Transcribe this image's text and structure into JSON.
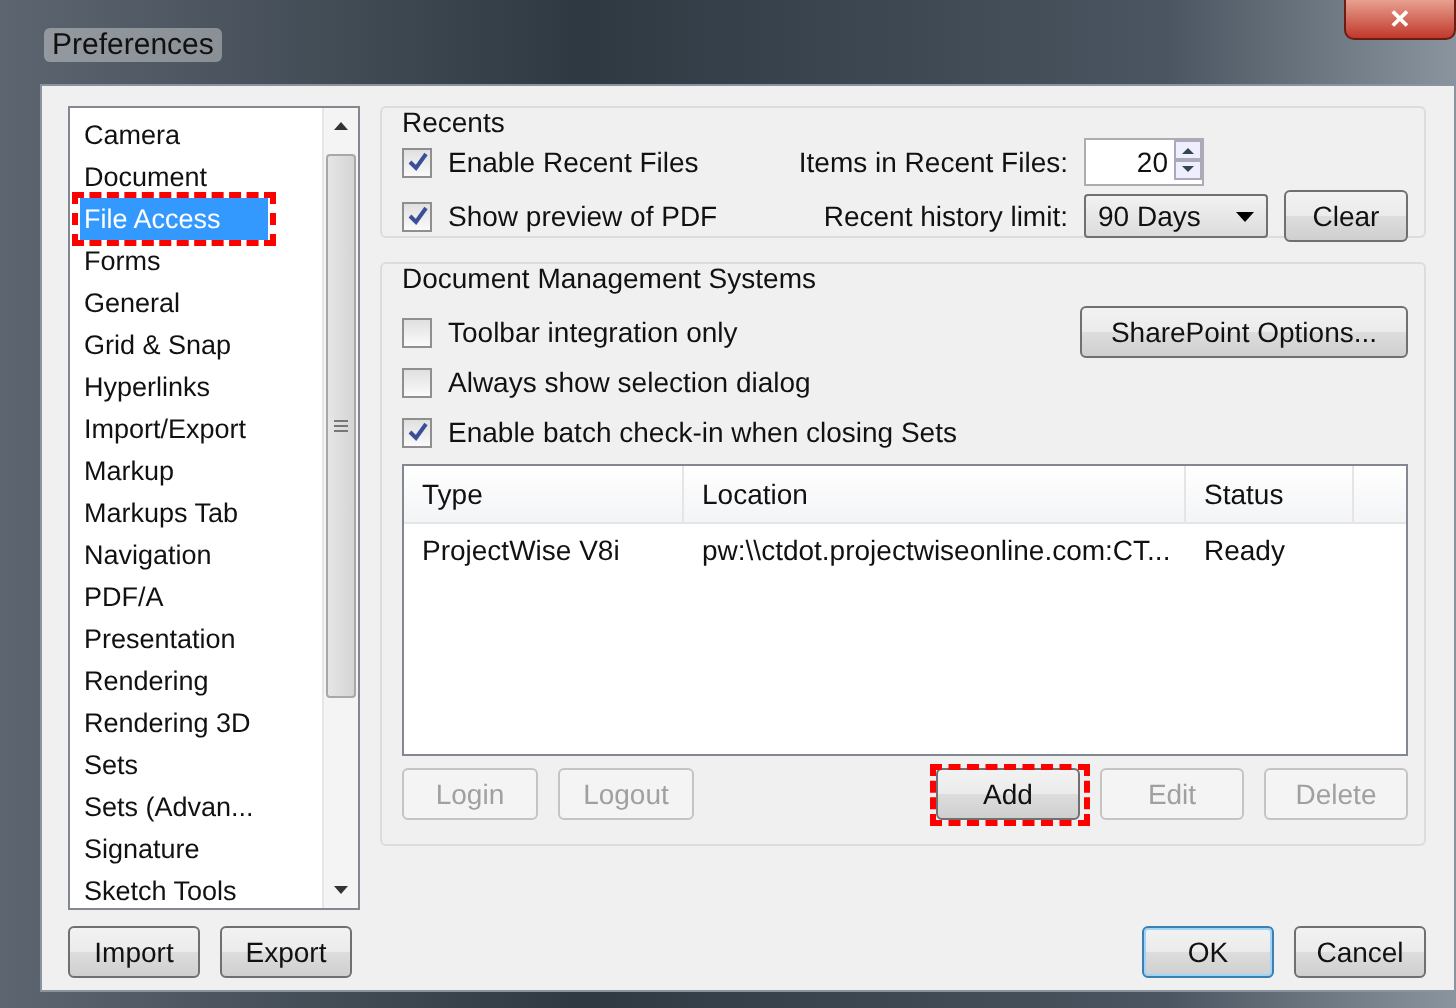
{
  "window": {
    "title": "Preferences",
    "close": "✕"
  },
  "sidebar": {
    "items": [
      {
        "label": "Camera",
        "selected": false
      },
      {
        "label": "Document",
        "selected": false
      },
      {
        "label": "File Access",
        "selected": true
      },
      {
        "label": "Forms",
        "selected": false
      },
      {
        "label": "General",
        "selected": false
      },
      {
        "label": "Grid & Snap",
        "selected": false
      },
      {
        "label": "Hyperlinks",
        "selected": false
      },
      {
        "label": "Import/Export",
        "selected": false
      },
      {
        "label": "Markup",
        "selected": false
      },
      {
        "label": "Markups Tab",
        "selected": false
      },
      {
        "label": "Navigation",
        "selected": false
      },
      {
        "label": "PDF/A",
        "selected": false
      },
      {
        "label": "Presentation",
        "selected": false
      },
      {
        "label": "Rendering",
        "selected": false
      },
      {
        "label": "Rendering 3D",
        "selected": false
      },
      {
        "label": "Sets",
        "selected": false
      },
      {
        "label": "Sets (Advan...",
        "selected": false
      },
      {
        "label": "Signature",
        "selected": false
      },
      {
        "label": "Sketch Tools",
        "selected": false
      }
    ],
    "buttons": [
      {
        "label": "Import",
        "disabled": false
      },
      {
        "label": "Export",
        "disabled": false
      }
    ]
  },
  "recents": {
    "title": "Recents",
    "checkboxes": [
      {
        "label": "Enable Recent Files",
        "checked": true
      },
      {
        "label": "Show preview of PDF",
        "checked": true
      }
    ],
    "items_label": "Items in Recent Files:",
    "items_value": "20",
    "history_label": "Recent history limit:",
    "history_value": "90 Days",
    "clear": "Clear"
  },
  "dms": {
    "title": "Document Management Systems",
    "checkboxes": [
      {
        "label": "Toolbar integration only",
        "checked": false
      },
      {
        "label": "Always show selection dialog",
        "checked": false
      },
      {
        "label": "Enable batch check-in when closing Sets",
        "checked": true
      }
    ],
    "sharepoint": "SharePoint Options...",
    "table": {
      "columns": [
        "Type",
        "Location",
        "Status"
      ],
      "rows": [
        [
          "ProjectWise V8i",
          "pw:\\\\ctdot.projectwiseonline.com:CT...",
          "Ready"
        ]
      ]
    },
    "buttons": [
      {
        "label": "Login",
        "disabled": true,
        "highlighted": false
      },
      {
        "label": "Logout",
        "disabled": true,
        "highlighted": false
      },
      {
        "label": "Add",
        "disabled": false,
        "highlighted": true
      },
      {
        "label": "Edit",
        "disabled": true,
        "highlighted": false
      },
      {
        "label": "Delete",
        "disabled": true,
        "highlighted": false
      }
    ]
  },
  "footer": [
    {
      "label": "OK",
      "default": true
    },
    {
      "label": "Cancel",
      "default": false
    }
  ]
}
